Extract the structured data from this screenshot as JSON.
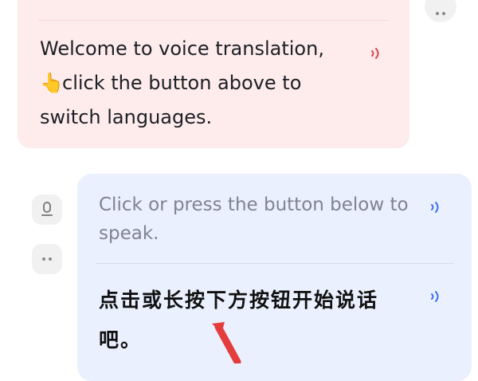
{
  "welcome": {
    "line1": "Welcome to voice translation,",
    "emoji": "👆",
    "line2": "click the button above to",
    "line3": "switch languages."
  },
  "prompt": {
    "english": "Click or press the button below to speak.",
    "chinese": "点击或长按下方按钮开始说话吧。"
  },
  "icons": {
    "speaker_pink": "speaker-icon",
    "speaker_blue": "speaker-icon",
    "mic": "microphone-icon",
    "more": "more-dots-icon",
    "pointer": "pointing-up-hand-icon",
    "annotation_arrow": "red-arrow-icon"
  },
  "colors": {
    "pink_bubble": "#fdeceb",
    "blue_bubble": "#eaf0fe",
    "speaker_red": "#e0424a",
    "speaker_blue": "#3a6ff2",
    "arrow_red": "#e53d3d"
  }
}
